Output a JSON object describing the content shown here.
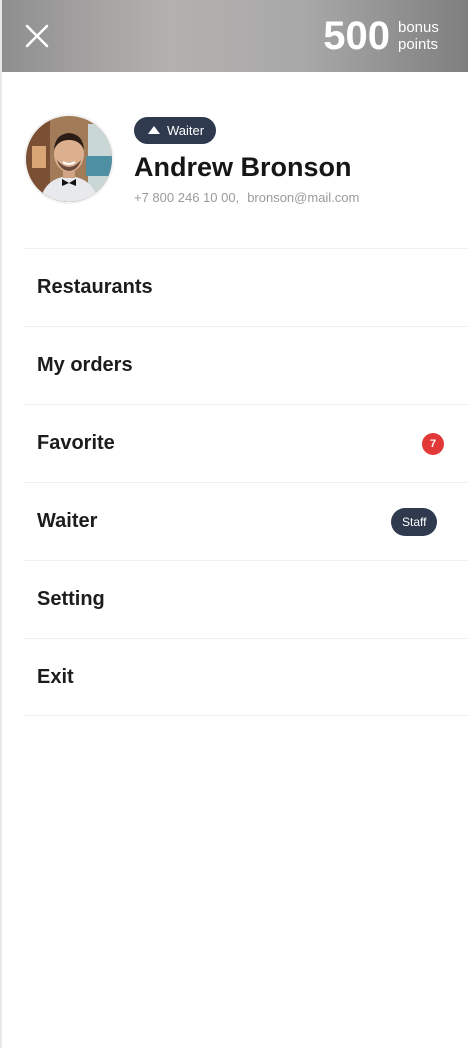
{
  "header": {
    "close_icon": "close-icon",
    "bonus_points": "500",
    "bonus_label": "bonus\npoints"
  },
  "profile": {
    "role_icon": "triangle-up-icon",
    "role": "Waiter",
    "name": "Andrew Bronson",
    "phone": "+7 800 246 10 00,",
    "email": "bronson@mail.com"
  },
  "menu": {
    "items": [
      {
        "label": "Restaurants"
      },
      {
        "label": "My orders"
      },
      {
        "label": "Favorite",
        "badge": "7"
      },
      {
        "label": "Waiter",
        "tag": "Staff"
      },
      {
        "label": "Setting"
      },
      {
        "label": "Exit"
      }
    ]
  },
  "colors": {
    "header_bg": "#a1a1a1",
    "badge_dark": "#2f3a4f",
    "notification_red": "#e23838",
    "text_dark": "#1c1c1c",
    "text_muted": "#9a9a9a"
  }
}
